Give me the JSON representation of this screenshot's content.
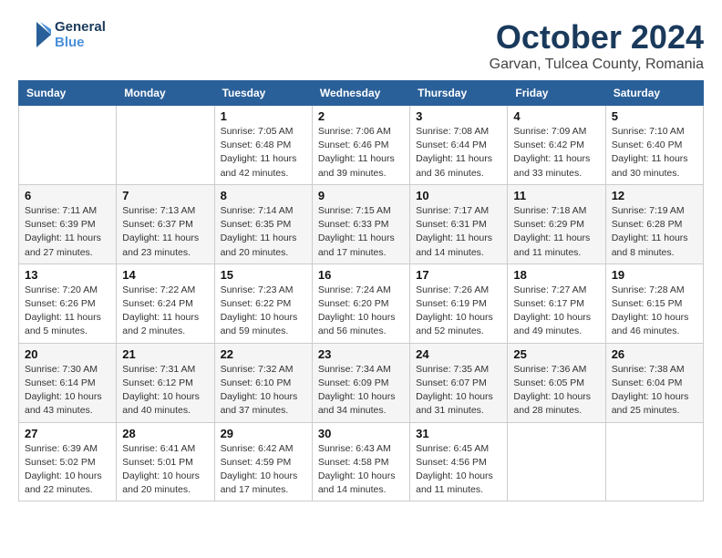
{
  "logo": {
    "text_general": "General",
    "text_blue": "Blue"
  },
  "title": "October 2024",
  "subtitle": "Garvan, Tulcea County, Romania",
  "weekdays": [
    "Sunday",
    "Monday",
    "Tuesday",
    "Wednesday",
    "Thursday",
    "Friday",
    "Saturday"
  ],
  "weeks": [
    [
      {
        "day": "",
        "info": ""
      },
      {
        "day": "",
        "info": ""
      },
      {
        "day": "1",
        "info": "Sunrise: 7:05 AM\nSunset: 6:48 PM\nDaylight: 11 hours and 42 minutes."
      },
      {
        "day": "2",
        "info": "Sunrise: 7:06 AM\nSunset: 6:46 PM\nDaylight: 11 hours and 39 minutes."
      },
      {
        "day": "3",
        "info": "Sunrise: 7:08 AM\nSunset: 6:44 PM\nDaylight: 11 hours and 36 minutes."
      },
      {
        "day": "4",
        "info": "Sunrise: 7:09 AM\nSunset: 6:42 PM\nDaylight: 11 hours and 33 minutes."
      },
      {
        "day": "5",
        "info": "Sunrise: 7:10 AM\nSunset: 6:40 PM\nDaylight: 11 hours and 30 minutes."
      }
    ],
    [
      {
        "day": "6",
        "info": "Sunrise: 7:11 AM\nSunset: 6:39 PM\nDaylight: 11 hours and 27 minutes."
      },
      {
        "day": "7",
        "info": "Sunrise: 7:13 AM\nSunset: 6:37 PM\nDaylight: 11 hours and 23 minutes."
      },
      {
        "day": "8",
        "info": "Sunrise: 7:14 AM\nSunset: 6:35 PM\nDaylight: 11 hours and 20 minutes."
      },
      {
        "day": "9",
        "info": "Sunrise: 7:15 AM\nSunset: 6:33 PM\nDaylight: 11 hours and 17 minutes."
      },
      {
        "day": "10",
        "info": "Sunrise: 7:17 AM\nSunset: 6:31 PM\nDaylight: 11 hours and 14 minutes."
      },
      {
        "day": "11",
        "info": "Sunrise: 7:18 AM\nSunset: 6:29 PM\nDaylight: 11 hours and 11 minutes."
      },
      {
        "day": "12",
        "info": "Sunrise: 7:19 AM\nSunset: 6:28 PM\nDaylight: 11 hours and 8 minutes."
      }
    ],
    [
      {
        "day": "13",
        "info": "Sunrise: 7:20 AM\nSunset: 6:26 PM\nDaylight: 11 hours and 5 minutes."
      },
      {
        "day": "14",
        "info": "Sunrise: 7:22 AM\nSunset: 6:24 PM\nDaylight: 11 hours and 2 minutes."
      },
      {
        "day": "15",
        "info": "Sunrise: 7:23 AM\nSunset: 6:22 PM\nDaylight: 10 hours and 59 minutes."
      },
      {
        "day": "16",
        "info": "Sunrise: 7:24 AM\nSunset: 6:20 PM\nDaylight: 10 hours and 56 minutes."
      },
      {
        "day": "17",
        "info": "Sunrise: 7:26 AM\nSunset: 6:19 PM\nDaylight: 10 hours and 52 minutes."
      },
      {
        "day": "18",
        "info": "Sunrise: 7:27 AM\nSunset: 6:17 PM\nDaylight: 10 hours and 49 minutes."
      },
      {
        "day": "19",
        "info": "Sunrise: 7:28 AM\nSunset: 6:15 PM\nDaylight: 10 hours and 46 minutes."
      }
    ],
    [
      {
        "day": "20",
        "info": "Sunrise: 7:30 AM\nSunset: 6:14 PM\nDaylight: 10 hours and 43 minutes."
      },
      {
        "day": "21",
        "info": "Sunrise: 7:31 AM\nSunset: 6:12 PM\nDaylight: 10 hours and 40 minutes."
      },
      {
        "day": "22",
        "info": "Sunrise: 7:32 AM\nSunset: 6:10 PM\nDaylight: 10 hours and 37 minutes."
      },
      {
        "day": "23",
        "info": "Sunrise: 7:34 AM\nSunset: 6:09 PM\nDaylight: 10 hours and 34 minutes."
      },
      {
        "day": "24",
        "info": "Sunrise: 7:35 AM\nSunset: 6:07 PM\nDaylight: 10 hours and 31 minutes."
      },
      {
        "day": "25",
        "info": "Sunrise: 7:36 AM\nSunset: 6:05 PM\nDaylight: 10 hours and 28 minutes."
      },
      {
        "day": "26",
        "info": "Sunrise: 7:38 AM\nSunset: 6:04 PM\nDaylight: 10 hours and 25 minutes."
      }
    ],
    [
      {
        "day": "27",
        "info": "Sunrise: 6:39 AM\nSunset: 5:02 PM\nDaylight: 10 hours and 22 minutes."
      },
      {
        "day": "28",
        "info": "Sunrise: 6:41 AM\nSunset: 5:01 PM\nDaylight: 10 hours and 20 minutes."
      },
      {
        "day": "29",
        "info": "Sunrise: 6:42 AM\nSunset: 4:59 PM\nDaylight: 10 hours and 17 minutes."
      },
      {
        "day": "30",
        "info": "Sunrise: 6:43 AM\nSunset: 4:58 PM\nDaylight: 10 hours and 14 minutes."
      },
      {
        "day": "31",
        "info": "Sunrise: 6:45 AM\nSunset: 4:56 PM\nDaylight: 10 hours and 11 minutes."
      },
      {
        "day": "",
        "info": ""
      },
      {
        "day": "",
        "info": ""
      }
    ]
  ]
}
